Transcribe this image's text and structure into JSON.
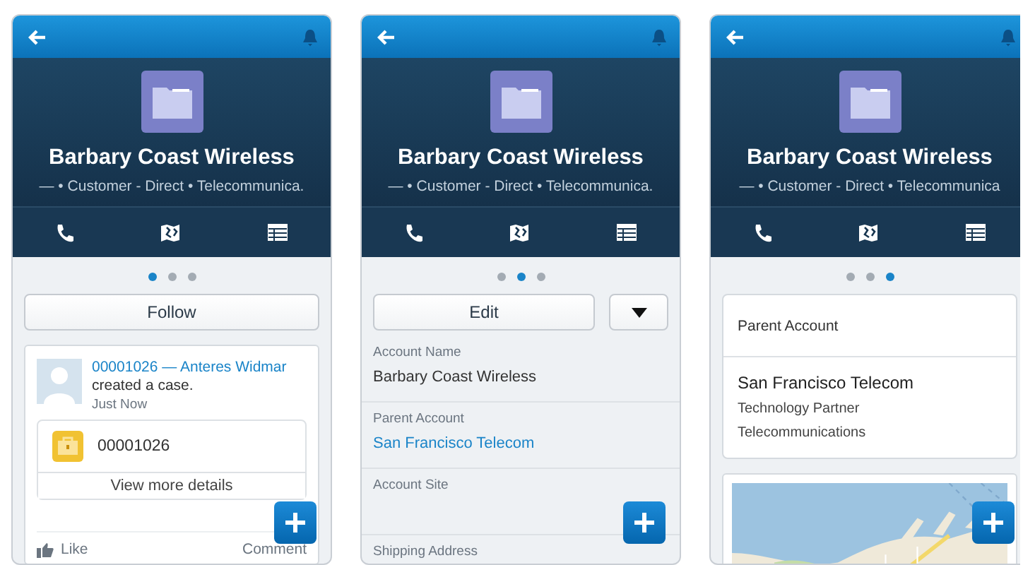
{
  "screens": [
    {
      "kind": "feed",
      "hero": {
        "title": "Barbary Coast Wireless",
        "subtitle": "— • Customer - Direct • Telecommunica."
      },
      "pager": [
        {
          "selected": true
        },
        {
          "selected": false
        },
        {
          "selected": false
        }
      ],
      "follow_button": "Follow",
      "post": {
        "case_link": "00001026",
        "separator": "—",
        "user_link": "Anteres Widmar",
        "text": "created a case.",
        "time": "Just Now",
        "case_number": "00001026",
        "details_link": "View more details"
      },
      "actions": [
        "Like",
        "Comment"
      ]
    },
    {
      "kind": "detail",
      "hero": {
        "title": "Barbary Coast Wireless",
        "subtitle": "— • Customer - Direct • Telecommunica."
      },
      "pager": [
        {
          "selected": false
        },
        {
          "selected": true
        },
        {
          "selected": false
        }
      ],
      "edit_button": "Edit",
      "fields": [
        {
          "label": "Account Name",
          "value": "Barbary Coast Wireless",
          "kind": "text"
        },
        {
          "label": "Parent Account",
          "value": "San Francisco Telecom",
          "kind": "link"
        },
        {
          "label": "Account Site"
        },
        {
          "label": "Shipping Address"
        }
      ]
    },
    {
      "kind": "related",
      "hero": {
        "title": "Barbary Coast Wireless",
        "subtitle": "— • Customer - Direct • Telecommunica"
      },
      "pager": [
        {
          "selected": false
        },
        {
          "selected": false
        },
        {
          "selected": true
        }
      ],
      "card": {
        "title": "Parent Account",
        "name": "San Francisco Telecom",
        "lines": [
          "Technology Partner",
          "Telecommunications"
        ]
      },
      "map": {
        "kind": "picture"
      }
    }
  ]
}
